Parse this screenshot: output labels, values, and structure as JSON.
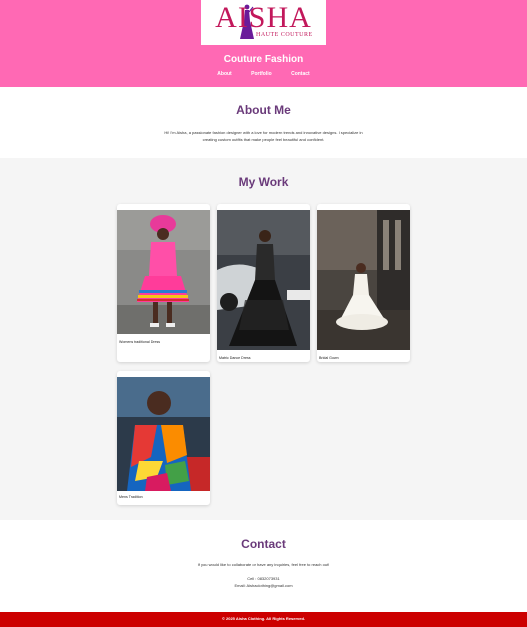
{
  "header": {
    "logo": {
      "text": "AISHA",
      "subtext": "HAUTE COUTURE"
    },
    "brand": "Couture Fashion",
    "nav": [
      "About",
      "Portfolio",
      "Contact"
    ],
    "bg_color": "#ff69b4"
  },
  "about": {
    "title": "About Me",
    "text": "Hi! I'm Aisha, a passionate fashion designer with a love for modern trends and innovative designs. I specialize in creating custom outfits that make people feel beautiful and confident."
  },
  "work": {
    "title": "My Work",
    "items": [
      {
        "caption": "Womens traditional Dress"
      },
      {
        "caption": "Matric Dance Dress"
      },
      {
        "caption": "Bridal Gown"
      },
      {
        "caption": "Mens Tradition"
      }
    ]
  },
  "contact": {
    "title": "Contact",
    "intro": "If you would like to collaborate or have any inquiries, feel free to reach out!",
    "cell": "Cell : 0832073931",
    "email": "Email: Aishaclothing@gmail.com"
  },
  "footer": {
    "text": "© 2025 Aisha Clothing. All Rights Reserved.",
    "bg_color": "#cc0000"
  }
}
